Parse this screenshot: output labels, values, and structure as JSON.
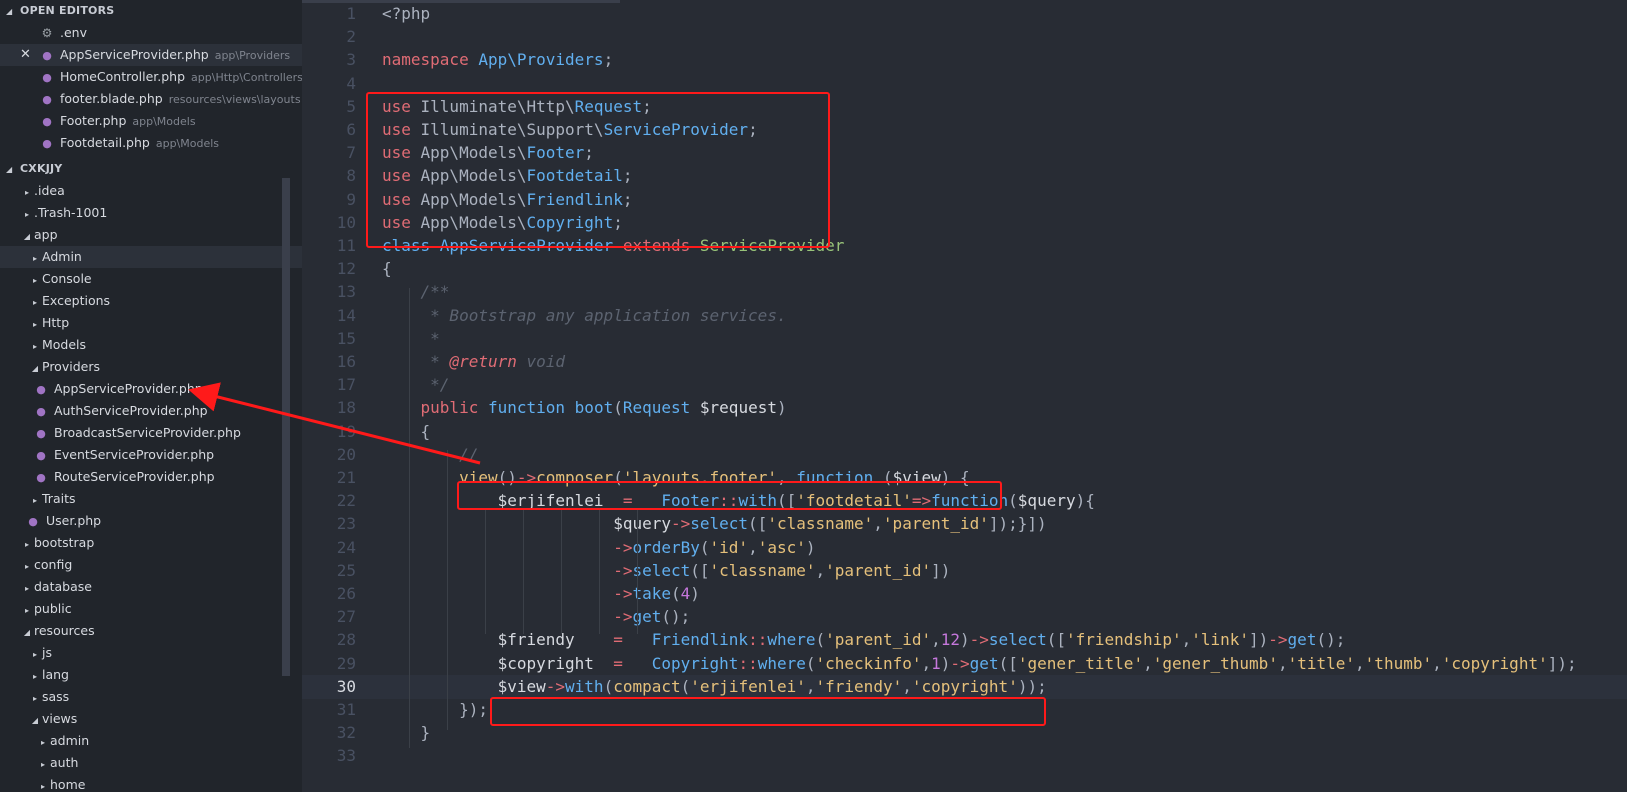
{
  "sidebar": {
    "open_editors": {
      "title": "OPEN EDITORS",
      "items": [
        {
          "label": ".env",
          "desc": "",
          "icon": "gear-icon",
          "selected": false
        },
        {
          "label": "AppServiceProvider.php",
          "desc": "app\\Providers",
          "icon": "php-icon",
          "selected": true
        },
        {
          "label": "HomeController.php",
          "desc": "app\\Http\\Controllers",
          "icon": "php-icon",
          "selected": false
        },
        {
          "label": "footer.blade.php",
          "desc": "resources\\views\\layouts",
          "icon": "php-icon",
          "selected": false
        },
        {
          "label": "Footer.php",
          "desc": "app\\Models",
          "icon": "php-icon",
          "selected": false
        },
        {
          "label": "Footdetail.php",
          "desc": "app\\Models",
          "icon": "php-icon",
          "selected": false
        }
      ]
    },
    "project": {
      "title": "CXKJJY",
      "tree": [
        {
          "label": ".idea",
          "indent": 1,
          "type": "folder-closed"
        },
        {
          "label": ".Trash-1001",
          "indent": 1,
          "type": "folder-closed"
        },
        {
          "label": "app",
          "indent": 1,
          "type": "folder-open"
        },
        {
          "label": "Admin",
          "indent": 2,
          "type": "folder-closed",
          "selected": true
        },
        {
          "label": "Console",
          "indent": 2,
          "type": "folder-closed"
        },
        {
          "label": "Exceptions",
          "indent": 2,
          "type": "folder-closed"
        },
        {
          "label": "Http",
          "indent": 2,
          "type": "folder-closed"
        },
        {
          "label": "Models",
          "indent": 2,
          "type": "folder-closed"
        },
        {
          "label": "Providers",
          "indent": 2,
          "type": "folder-open"
        },
        {
          "label": "AppServiceProvider.php",
          "indent": 3,
          "type": "php"
        },
        {
          "label": "AuthServiceProvider.php",
          "indent": 3,
          "type": "php"
        },
        {
          "label": "BroadcastServiceProvider.php",
          "indent": 3,
          "type": "php"
        },
        {
          "label": "EventServiceProvider.php",
          "indent": 3,
          "type": "php"
        },
        {
          "label": "RouteServiceProvider.php",
          "indent": 3,
          "type": "php"
        },
        {
          "label": "Traits",
          "indent": 2,
          "type": "folder-closed"
        },
        {
          "label": "User.php",
          "indent": 2,
          "type": "php"
        },
        {
          "label": "bootstrap",
          "indent": 1,
          "type": "folder-closed"
        },
        {
          "label": "config",
          "indent": 1,
          "type": "folder-closed"
        },
        {
          "label": "database",
          "indent": 1,
          "type": "folder-closed"
        },
        {
          "label": "public",
          "indent": 1,
          "type": "folder-closed"
        },
        {
          "label": "resources",
          "indent": 1,
          "type": "folder-open"
        },
        {
          "label": "js",
          "indent": 2,
          "type": "folder-closed"
        },
        {
          "label": "lang",
          "indent": 2,
          "type": "folder-closed"
        },
        {
          "label": "sass",
          "indent": 2,
          "type": "folder-closed"
        },
        {
          "label": "views",
          "indent": 2,
          "type": "folder-open"
        },
        {
          "label": "admin",
          "indent": 3,
          "type": "folder-closed"
        },
        {
          "label": "auth",
          "indent": 3,
          "type": "folder-closed"
        },
        {
          "label": "home",
          "indent": 3,
          "type": "folder-closed"
        }
      ]
    }
  },
  "editor": {
    "current_line": 30,
    "lines": [
      [
        [
          "punc",
          "<?php"
        ]
      ],
      [],
      [
        [
          "kw",
          "namespace "
        ],
        [
          "ns",
          "App\\Providers"
        ],
        [
          "punc",
          ";"
        ]
      ],
      [],
      [
        [
          "kw",
          "use "
        ],
        [
          "punc",
          "Illuminate\\Http\\"
        ],
        [
          "cls",
          "Request"
        ],
        [
          "punc",
          ";"
        ]
      ],
      [
        [
          "kw",
          "use "
        ],
        [
          "punc",
          "Illuminate\\Support\\"
        ],
        [
          "cls",
          "ServiceProvider"
        ],
        [
          "punc",
          ";"
        ]
      ],
      [
        [
          "kw",
          "use "
        ],
        [
          "punc",
          "App\\Models\\"
        ],
        [
          "cls",
          "Footer"
        ],
        [
          "punc",
          ";"
        ]
      ],
      [
        [
          "kw",
          "use "
        ],
        [
          "punc",
          "App\\Models\\"
        ],
        [
          "cls",
          "Footdetail"
        ],
        [
          "punc",
          ";"
        ]
      ],
      [
        [
          "kw",
          "use "
        ],
        [
          "punc",
          "App\\Models\\"
        ],
        [
          "cls",
          "Friendlink"
        ],
        [
          "punc",
          ";"
        ]
      ],
      [
        [
          "kw",
          "use "
        ],
        [
          "punc",
          "App\\Models\\"
        ],
        [
          "cls",
          "Copyright"
        ],
        [
          "punc",
          ";"
        ]
      ],
      [
        [
          "kwb",
          "class "
        ],
        [
          "cls",
          "AppServiceProvider "
        ],
        [
          "kw",
          "extends "
        ],
        [
          "cls-green",
          "ServiceProvider"
        ]
      ],
      [
        [
          "punc",
          "{"
        ]
      ],
      [
        [
          "punc",
          "    "
        ],
        [
          "cmt",
          "/**"
        ]
      ],
      [
        [
          "punc",
          "    "
        ],
        [
          "cmt",
          " * Bootstrap any application services."
        ]
      ],
      [
        [
          "punc",
          "    "
        ],
        [
          "cmt",
          " *"
        ]
      ],
      [
        [
          "punc",
          "    "
        ],
        [
          "cmt",
          " * "
        ],
        [
          "tag",
          "@return"
        ],
        [
          "cmt",
          " void"
        ]
      ],
      [
        [
          "punc",
          "    "
        ],
        [
          "cmt",
          " */"
        ]
      ],
      [
        [
          "punc",
          "    "
        ],
        [
          "kw",
          "public "
        ],
        [
          "kwb",
          "function "
        ],
        [
          "fn",
          "boot"
        ],
        [
          "punc",
          "("
        ],
        [
          "cls",
          "Request "
        ],
        [
          "var",
          "$request"
        ],
        [
          "punc",
          ")"
        ]
      ],
      [
        [
          "punc",
          "    {"
        ]
      ],
      [
        [
          "punc",
          "        "
        ],
        [
          "cmt",
          "//"
        ]
      ],
      [
        [
          "punc",
          "        "
        ],
        [
          "fn-y",
          "view"
        ],
        [
          "punc",
          "()"
        ],
        [
          "op",
          "->"
        ],
        [
          "fn-y",
          "composer"
        ],
        [
          "punc",
          "("
        ],
        [
          "str",
          "'layouts.footer'"
        ],
        [
          "punc",
          ", "
        ],
        [
          "kwb",
          "function "
        ],
        [
          "punc",
          "("
        ],
        [
          "var",
          "$view"
        ],
        [
          "punc",
          ") {"
        ]
      ],
      [
        [
          "punc",
          "            "
        ],
        [
          "var",
          "$erjifenlei  "
        ],
        [
          "op",
          "="
        ],
        [
          "punc",
          "   "
        ],
        [
          "cls",
          "Footer"
        ],
        [
          "op",
          "::"
        ],
        [
          "fn",
          "with"
        ],
        [
          "punc",
          "(["
        ],
        [
          "str",
          "'footdetail'"
        ],
        [
          "op",
          "=>"
        ],
        [
          "kwb",
          "function"
        ],
        [
          "punc",
          "("
        ],
        [
          "var",
          "$query"
        ],
        [
          "punc",
          "){"
        ]
      ],
      [
        [
          "punc",
          "                        "
        ],
        [
          "var",
          "$query"
        ],
        [
          "op",
          "->"
        ],
        [
          "fn",
          "select"
        ],
        [
          "punc",
          "(["
        ],
        [
          "str",
          "'classname'"
        ],
        [
          "punc",
          ","
        ],
        [
          "str",
          "'parent_id'"
        ],
        [
          "punc",
          "]);}])"
        ]
      ],
      [
        [
          "punc",
          "                        "
        ],
        [
          "op",
          "->"
        ],
        [
          "fn",
          "orderBy"
        ],
        [
          "punc",
          "("
        ],
        [
          "str",
          "'id'"
        ],
        [
          "punc",
          ","
        ],
        [
          "str",
          "'asc'"
        ],
        [
          "punc",
          ")"
        ]
      ],
      [
        [
          "punc",
          "                        "
        ],
        [
          "op",
          "->"
        ],
        [
          "fn",
          "select"
        ],
        [
          "punc",
          "(["
        ],
        [
          "str",
          "'classname'"
        ],
        [
          "punc",
          ","
        ],
        [
          "str",
          "'parent_id'"
        ],
        [
          "punc",
          "])"
        ]
      ],
      [
        [
          "punc",
          "                        "
        ],
        [
          "op",
          "->"
        ],
        [
          "fn",
          "take"
        ],
        [
          "punc",
          "("
        ],
        [
          "kwp",
          "4"
        ],
        [
          "punc",
          ")"
        ]
      ],
      [
        [
          "punc",
          "                        "
        ],
        [
          "op",
          "->"
        ],
        [
          "fn",
          "get"
        ],
        [
          "punc",
          "();"
        ]
      ],
      [
        [
          "punc",
          "            "
        ],
        [
          "var",
          "$friendy    "
        ],
        [
          "op",
          "="
        ],
        [
          "punc",
          "   "
        ],
        [
          "cls",
          "Friendlink"
        ],
        [
          "op",
          "::"
        ],
        [
          "fn",
          "where"
        ],
        [
          "punc",
          "("
        ],
        [
          "str",
          "'parent_id'"
        ],
        [
          "punc",
          ","
        ],
        [
          "kwp",
          "12"
        ],
        [
          "punc",
          ")"
        ],
        [
          "op",
          "->"
        ],
        [
          "fn",
          "select"
        ],
        [
          "punc",
          "(["
        ],
        [
          "str",
          "'friendship'"
        ],
        [
          "punc",
          ","
        ],
        [
          "str",
          "'link'"
        ],
        [
          "punc",
          "])"
        ],
        [
          "op",
          "->"
        ],
        [
          "fn",
          "get"
        ],
        [
          "punc",
          "();"
        ]
      ],
      [
        [
          "punc",
          "            "
        ],
        [
          "var",
          "$copyright  "
        ],
        [
          "op",
          "="
        ],
        [
          "punc",
          "   "
        ],
        [
          "cls",
          "Copyright"
        ],
        [
          "op",
          "::"
        ],
        [
          "fn",
          "where"
        ],
        [
          "punc",
          "("
        ],
        [
          "str",
          "'checkinfo'"
        ],
        [
          "punc",
          ","
        ],
        [
          "kwp",
          "1"
        ],
        [
          "punc",
          ")"
        ],
        [
          "op",
          "->"
        ],
        [
          "fn",
          "get"
        ],
        [
          "punc",
          "(["
        ],
        [
          "str",
          "'gener_title'"
        ],
        [
          "punc",
          ","
        ],
        [
          "str",
          "'gener_thumb'"
        ],
        [
          "punc",
          ","
        ],
        [
          "str",
          "'title'"
        ],
        [
          "punc",
          ","
        ],
        [
          "str",
          "'thumb'"
        ],
        [
          "punc",
          ","
        ],
        [
          "str",
          "'copyright'"
        ],
        [
          "punc",
          "]);"
        ]
      ],
      [
        [
          "punc",
          "            "
        ],
        [
          "var",
          "$view"
        ],
        [
          "op",
          "->"
        ],
        [
          "fn",
          "with"
        ],
        [
          "punc",
          "("
        ],
        [
          "fn-y",
          "compact"
        ],
        [
          "punc",
          "("
        ],
        [
          "str",
          "'erjifenlei'"
        ],
        [
          "punc",
          ","
        ],
        [
          "str",
          "'friendy'"
        ],
        [
          "punc",
          ","
        ],
        [
          "str",
          "'copyright'"
        ],
        [
          "punc",
          "));"
        ]
      ],
      [
        [
          "punc",
          "        });"
        ]
      ],
      [
        [
          "punc",
          "    }"
        ]
      ],
      []
    ]
  },
  "colors": {
    "annotation": "#ff1a1a",
    "php_icon": "#a074c4"
  }
}
